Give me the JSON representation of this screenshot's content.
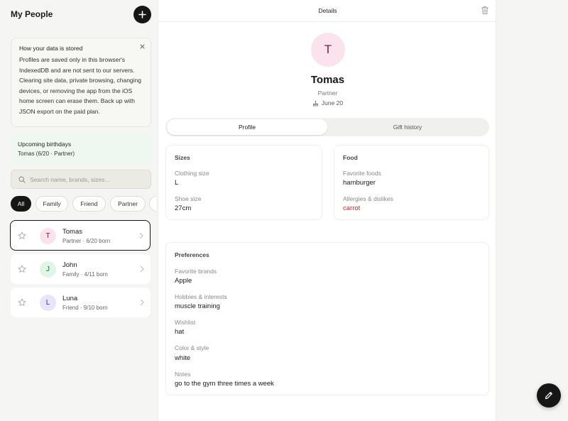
{
  "sidebar": {
    "title": "My People",
    "notice": {
      "title": "How your data is stored",
      "body": "Profiles are saved only in this browser's IndexedDB and are not sent to our servers. Clearing site data, private browsing, changing devices, or removing the app from the iOS home screen can erase them. Back up with JSON export on the paid plan."
    },
    "birthdays": {
      "title": "Upcoming birthdays",
      "item": "Tomas (6/20 · Partner)"
    },
    "search": {
      "placeholder": "Search name, brands, sizes...",
      "value": ""
    },
    "filters": [
      "All",
      "Family",
      "Friend",
      "Partner",
      ""
    ],
    "people": [
      {
        "initial": "T",
        "name": "Tomas",
        "meta": "Partner · 6/20 born"
      },
      {
        "initial": "J",
        "name": "John",
        "meta": "Family · 4/11 born"
      },
      {
        "initial": "L",
        "name": "Luna",
        "meta": "Friend · 9/10 born"
      }
    ]
  },
  "detail": {
    "title": "Details",
    "initial": "T",
    "name": "Tomas",
    "relation": "Partner",
    "birthday": "June 20",
    "tabs": [
      "Profile",
      "Gift history"
    ],
    "sizes": {
      "title": "Sizes",
      "clothing_label": "Clothing size",
      "clothing_value": "L",
      "shoe_label": "Shoe size",
      "shoe_value": "27cm"
    },
    "food": {
      "title": "Food",
      "favorite_label": "Favorite foods",
      "favorite_value": "hamburger",
      "allergy_label": "Allergies & dislikes",
      "allergy_value": "carrot"
    },
    "preferences": {
      "title": "Preferences",
      "brands_label": "Favorite brands",
      "brands_value": "Apple",
      "hobbies_label": "Hobbies & interests",
      "hobbies_value": "muscle training",
      "wishlist_label": "Wishlist",
      "wishlist_value": "hat",
      "color_label": "Color & style",
      "color_value": "white",
      "notes_label": "Notes",
      "notes_value": "go to the gym three times a week"
    }
  },
  "colors": {
    "accent": "#161616",
    "allergy": "#c62828",
    "avatar_t": "#fbe3ee",
    "avatar_j": "#dff5e6",
    "avatar_l": "#e7e5fb",
    "birthday_bg": "#eef8f1"
  },
  "icons": [
    "plus-icon",
    "close-icon",
    "search-icon",
    "star-icon",
    "chevron-right-icon",
    "trash-icon",
    "cake-icon",
    "pencil-icon"
  ]
}
